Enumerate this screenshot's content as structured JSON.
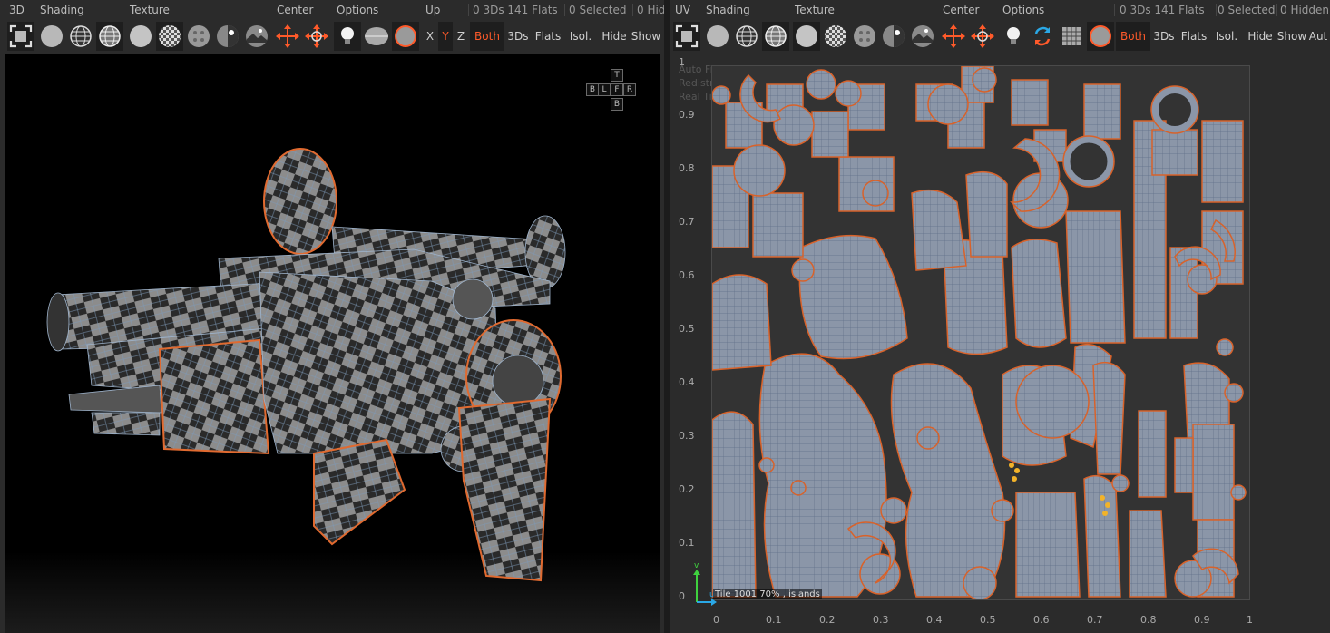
{
  "left": {
    "menu": {
      "mode": "3D",
      "shading": "Shading",
      "texture": "Texture",
      "center": "Center",
      "options": "Options",
      "up": "Up",
      "stats": "0 3Ds 141 Flats",
      "selected": "0 Selected",
      "hidden": "0 Hid"
    },
    "toolbar": {
      "x": "X",
      "y": "Y",
      "z": "Z",
      "both": "Both",
      "threeds": "3Ds",
      "flats": "Flats",
      "isol": "Isol.",
      "hide": "Hide",
      "show": "Show"
    },
    "navcube": {
      "top": "T",
      "back": "B",
      "left": "L",
      "front": "F",
      "right": "R",
      "bottom": "B"
    }
  },
  "right": {
    "menu": {
      "mode": "UV",
      "shading": "Shading",
      "texture": "Texture",
      "center": "Center",
      "options": "Options",
      "stats": "0 3Ds 141 Flats",
      "selected": "0 Selected",
      "hidden": "0 Hidden"
    },
    "toolbar": {
      "both": "Both",
      "threeds": "3Ds",
      "flats": "Flats",
      "isol": "Isol.",
      "hide": "Hide",
      "show": "Show",
      "auto": "Aut"
    },
    "hints": [
      "Auto Fit On",
      "Redistribution",
      "Real Time Optimiz"
    ],
    "axis_y": [
      "1",
      "0.9",
      "0.8",
      "0.7",
      "0.6",
      "0.5",
      "0.4",
      "0.3",
      "0.2",
      "0.1",
      "0"
    ],
    "axis_x": [
      "0",
      "0.1",
      "0.2",
      "0.3",
      "0.4",
      "0.5",
      "0.6",
      "0.7",
      "0.8",
      "0.9",
      "1"
    ],
    "tile_label": "Tile 1001 70% , islands",
    "gizmo": {
      "v": "v",
      "u": "u"
    }
  },
  "colors": {
    "accent": "#ff5a2a",
    "panel": "#2b2b2b",
    "button_dark": "#1e1e1e",
    "uv_island_fill": "#8a96a8",
    "uv_island_edge": "#d8622a",
    "checker_light": "#8c8c8c",
    "checker_dark": "#2a2a2a"
  },
  "icons": [
    "frame-icon",
    "sphere-flat-icon",
    "sphere-wire-icon",
    "sphere-wire-shaded-icon",
    "sphere-smooth-icon",
    "checker-sphere-icon",
    "sphere-dots-icon",
    "light-sphere-icon",
    "env-sphere-icon",
    "move-center-icon",
    "move-center-alt-icon",
    "lightbulb-icon",
    "ellipse-icon",
    "circle-orange-icon",
    "swap-icon",
    "grid-icon"
  ]
}
